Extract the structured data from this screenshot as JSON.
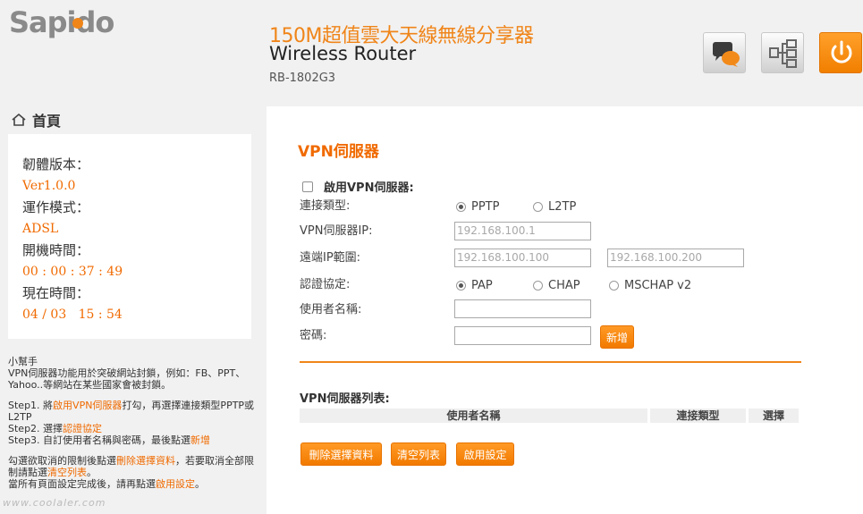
{
  "header": {
    "logo_text": "Sapido",
    "product_title": "150M超值雲大天線無線分享器",
    "product_subtitle": "Wireless Router",
    "model": "RB-1802G3",
    "buttons": {
      "chat": "chat-icon",
      "network": "network-icon",
      "power": "power-icon"
    }
  },
  "sidebar": {
    "home_label": "首頁",
    "status": {
      "firmware_label": "韌體版本：",
      "firmware_value": "Ver1.0.0",
      "mode_label": "運作模式：",
      "mode_value": "ADSL",
      "uptime_label": "開機時間：",
      "uptime_value": "00 : 00 : 37 : 49",
      "time_label": "現在時間：",
      "time_value": "04 / 03   15 : 54"
    },
    "help": {
      "title": "小幫手",
      "intro": "VPN伺服器功能用於突破網站封鎖，例如：FB、PPT、Yahoo..等網站在某些國家會被封鎖。",
      "step1_a": "Step1. 將",
      "step1_link": "啟用VPN伺服器",
      "step1_b": "打勾，再選擇連接類型PPTP或L2TP",
      "step2_a": "Step2. 選擇",
      "step2_link": "認證協定",
      "step3_a": "Step3. 自訂使用者名稱與密碼，最後點選",
      "step3_link": "新增",
      "note1_a": "勾選欲取消的限制後點選",
      "note1_link": "刪除選擇資料",
      "note1_b": "，若要取消全部限制請點選",
      "note1_link2": "清空列表",
      "note1_c": "。",
      "note2_a": "當所有頁面設定完成後，請再點選",
      "note2_link": "啟用設定",
      "note2_b": "。"
    },
    "watermark": "www.coolaler.com"
  },
  "main": {
    "title": "VPN伺服器",
    "enable_label": "啟用VPN伺服器:",
    "conn_type_label": "連接類型:",
    "conn_options": [
      "PPTP",
      "L2TP"
    ],
    "server_ip_label": "VPN伺服器IP:",
    "server_ip_placeholder": "192.168.100.1",
    "remote_range_label": "遠端IP範圍:",
    "remote_start_placeholder": "192.168.100.100",
    "remote_end_placeholder": "192.168.100.200",
    "auth_label": "認證協定:",
    "auth_options": [
      "PAP",
      "CHAP",
      "MSCHAP v2"
    ],
    "username_label": "使用者名稱:",
    "password_label": "密碼:",
    "add_button": "新增",
    "list_title": "VPN伺服器列表:",
    "list_columns": [
      "使用者名稱",
      "連接類型",
      "選擇"
    ],
    "delete_button": "刪除選擇資料",
    "clear_button": "清空列表",
    "apply_button": "啟用設定"
  }
}
